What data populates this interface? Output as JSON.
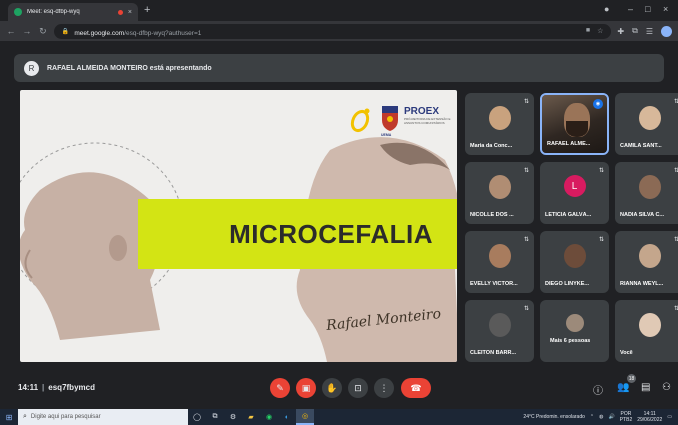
{
  "browser": {
    "tab_title": "Meet: esq-dfbp-wyq",
    "tab_close": "×",
    "new_tab": "+",
    "url_host": "meet.google.com",
    "url_path": "/esq-dfbp-wyq?authuser=1",
    "window_controls": [
      "●",
      "–",
      "□",
      "×"
    ]
  },
  "presenter": {
    "initial": "R",
    "text": "RAFAEL ALMEIDA MONTEIRO está apresentando"
  },
  "slide": {
    "title": "MICROCEFALIA",
    "logo_text": "PROEX",
    "logo_subtitle": "PRÓ-REITORIA DE EXTENSÃO E ASSUNTOS COMUNITÁRIOS",
    "logo_crest_label": "UEMA",
    "signature": "Rafael Monteiro"
  },
  "participants": [
    {
      "name": "Maria da Conc...",
      "kind": "photo",
      "color": "#c9a27e"
    },
    {
      "name": "RAFAEL ALME...",
      "kind": "video",
      "active": true
    },
    {
      "name": "CAMILA SANT...",
      "kind": "photo",
      "color": "#d7b89a"
    },
    {
      "name": "NICOLLE DOS ...",
      "kind": "photo",
      "color": "#b08d73"
    },
    {
      "name": "LETICIA GALVÃ...",
      "kind": "letter",
      "letter": "L",
      "color": "#d81b60"
    },
    {
      "name": "NADIA SILVA C...",
      "kind": "photo",
      "color": "#8b6a55"
    },
    {
      "name": "EVELLY VICTÓR...",
      "kind": "photo",
      "color": "#a87c5e"
    },
    {
      "name": "DIEGO LINYKE...",
      "kind": "photo",
      "color": "#6d4c3a"
    },
    {
      "name": "RIANNA WEYL...",
      "kind": "photo",
      "color": "#c4a68c"
    },
    {
      "name": "CLEITON BARR...",
      "kind": "photo",
      "color": "#5a5a5a"
    },
    {
      "name": "Mais 6 pessoas",
      "kind": "more",
      "color": "#9c8a7a"
    },
    {
      "name": "Você",
      "kind": "photo",
      "color": "#e0c9b5"
    }
  ],
  "meeting": {
    "time": "14:11",
    "code": "esq7fbymcd",
    "participant_count": "18"
  },
  "taskbar": {
    "search_placeholder": "Digite aqui para pesquisar",
    "weather": "24°C Predomin. ensolarado",
    "lang": "POR",
    "lang_sub": "PTB2",
    "clock_time": "14:11",
    "clock_date": "29/06/2022"
  }
}
